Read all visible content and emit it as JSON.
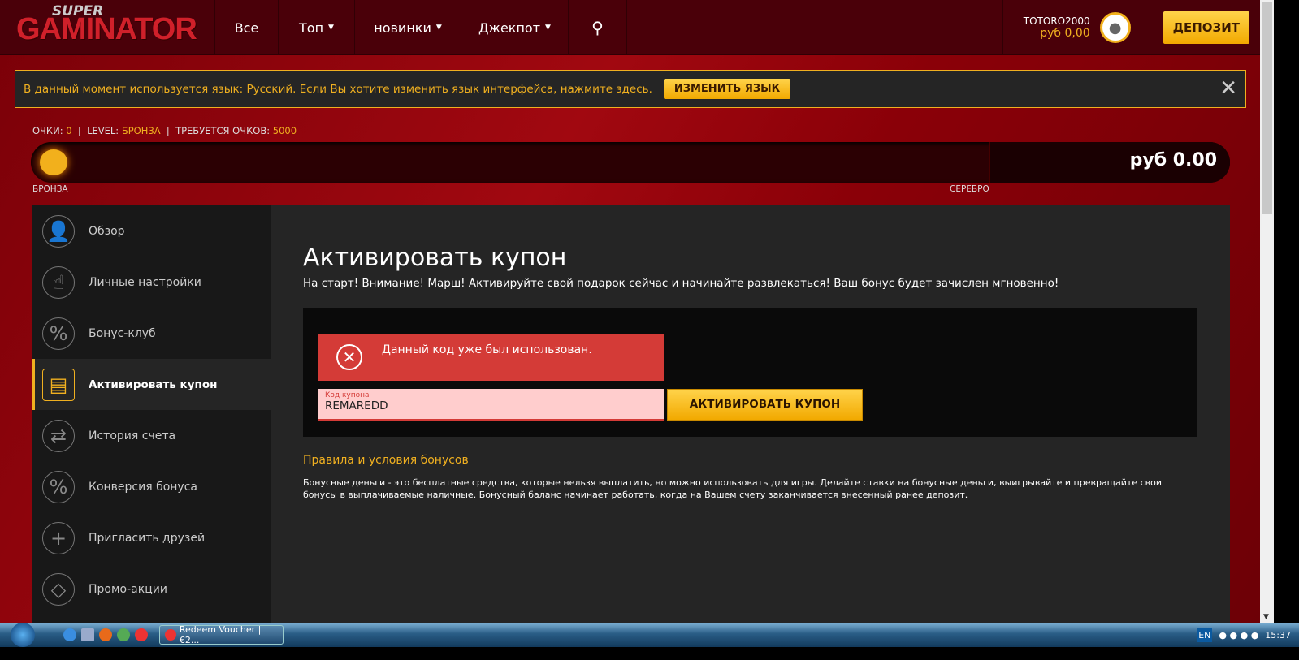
{
  "header": {
    "logo_super": "SUPER",
    "logo_main": "GAMINATOR",
    "nav": [
      "Все",
      "Топ",
      "новинки",
      "Джекпот"
    ],
    "username": "TOTORO2000",
    "balance": "руб 0,00",
    "deposit": "ДЕПОЗИТ"
  },
  "lang_banner": {
    "text": "В данный момент используется язык: Русский. Если Вы хотите изменить язык интерфейса, нажмите здесь.",
    "button": "ИЗМЕНИТЬ ЯЗЫК",
    "close": "✕"
  },
  "points": {
    "label_points": "ОЧКИ:",
    "points": "0",
    "label_level": "LEVEL:",
    "level": "БРОНЗА",
    "label_required": "ТРЕБУЕТСЯ ОЧКОВ:",
    "required": "5000",
    "progress_percent": 0,
    "balance": "руб 0.00",
    "level_left": "БРОНЗА",
    "level_right": "СЕРЕБРО"
  },
  "sidebar": {
    "items": [
      {
        "label": "Обзор",
        "icon": "👤"
      },
      {
        "label": "Личные настройки",
        "icon": "☝"
      },
      {
        "label": "Бонус-клуб",
        "icon": "%"
      },
      {
        "label": "Активировать купон",
        "icon": "▤"
      },
      {
        "label": "История счета",
        "icon": "⇄"
      },
      {
        "label": "Конверсия бонуса",
        "icon": "%"
      },
      {
        "label": "Пригласить друзей",
        "icon": "+"
      },
      {
        "label": "Промо-акции",
        "icon": "◇"
      }
    ]
  },
  "main": {
    "title": "Активировать купон",
    "subtitle": "На старт! Внимание! Марш! Активируйте свой подарок сейчас и начинайте развлекаться! Ваш бонус будет зачислен мгновенно!",
    "error": "Данный код уже был использован.",
    "coupon_label": "Код купона",
    "coupon_value": "REMAREDD",
    "activate_button": "АКТИВИРОВАТЬ КУПОН",
    "rules_link": "Правила и условия бонусов",
    "rules_text": "Бонусные деньги - это бесплатные средства, которые нельзя выплатить, но можно использовать для игры. Делайте ставки на бонусные деньги, выигрывайте и превращайте свои бонусы в выплачиваемые наличные. Бонусный баланс начинает работать, когда на Вашем счету заканчивается внесенный ранее депозит."
  },
  "taskbar": {
    "task": "Redeem Voucher | €2...",
    "lang": "EN",
    "time": "15:37"
  }
}
